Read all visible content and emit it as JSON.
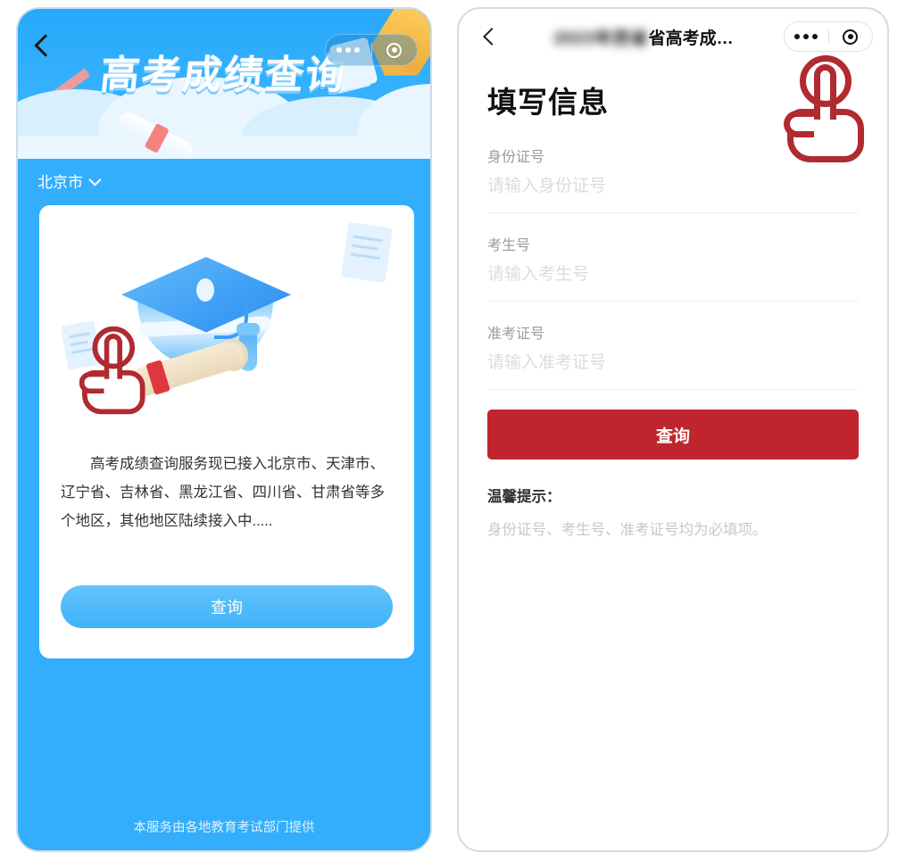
{
  "left_screen": {
    "nav": {
      "back_icon": "back-chevron-icon",
      "capsule": {
        "more_icon": "more-dots-icon",
        "target_icon": "target-circle-icon"
      }
    },
    "banner": {
      "title": "高考成绩查询"
    },
    "region_selector": {
      "value": "北京市",
      "chevron_icon": "chevron-down-icon"
    },
    "card": {
      "illustration": "graduation-cap-illustration",
      "description": "高考成绩查询服务现已接入北京市、天津市、辽宁省、吉林省、黑龙江省、四川省、甘肃省等多个地区，其他地区陆续接入中.....",
      "query_button": "查询"
    },
    "footer": "本服务由各地教育考试部门提供",
    "colors": {
      "background": "#32aefc",
      "button": "#3fb2f7"
    }
  },
  "right_screen": {
    "nav": {
      "back_icon": "back-chevron-icon",
      "title_blurred": "2023年西省",
      "title": "省高考成…",
      "capsule": {
        "more_icon": "more-dots-icon",
        "target_icon": "target-circle-icon"
      }
    },
    "heading": "填写信息",
    "fields": [
      {
        "label": "身份证号",
        "placeholder": "请输入身份证号",
        "value": ""
      },
      {
        "label": "考生号",
        "placeholder": "请输入考生号",
        "value": ""
      },
      {
        "label": "准考证号",
        "placeholder": "请输入准考证号",
        "value": ""
      }
    ],
    "query_button": "查询",
    "tips": {
      "title": "温馨提示：",
      "body": "身份证号、考生号、准考证号均为必填项。"
    },
    "colors": {
      "button": "#bf252d",
      "label": "#9a9a9a",
      "placeholder": "#dcdcdc"
    }
  },
  "cursor": {
    "icon": "tap-hand-icon",
    "color": "#b02a30"
  }
}
